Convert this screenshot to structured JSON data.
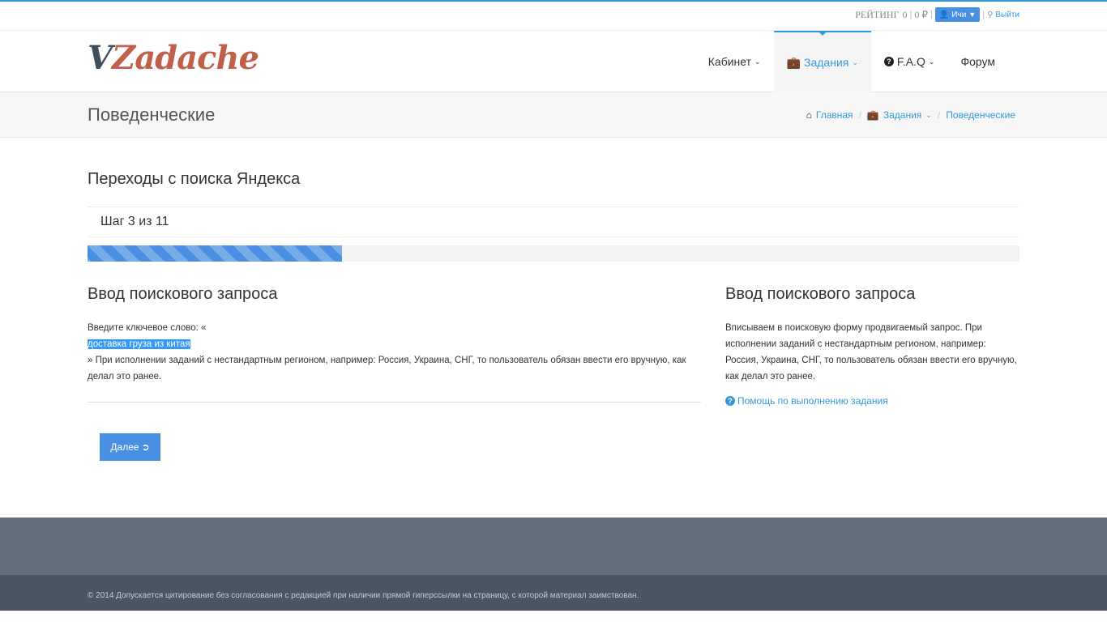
{
  "topbar": {
    "rating_label": "РЕЙТИНГ",
    "rating_value": "0",
    "balance": "0 ₽",
    "user_label": "Ичи",
    "logout_label": "Выйти"
  },
  "header": {
    "logo_v": "V",
    "logo_rest": "Zadache",
    "nav": [
      {
        "label": "Кабинет"
      },
      {
        "label": "Задания"
      },
      {
        "label": "F.A.Q"
      },
      {
        "label": "Форум"
      }
    ]
  },
  "breadcrumb": {
    "page_title": "Поведенческие",
    "items": [
      "Главная",
      "Задания",
      "Поведенческие"
    ]
  },
  "task": {
    "title": "Переходы с поиска Яндекса",
    "step_text": "Шаг 3 из 11",
    "progress_fraction": 0.273
  },
  "left": {
    "section_title": "Ввод поискового запроса",
    "intro": "Введите ключевое слово: «",
    "keyword": "доставка груза из китая",
    "rest": "» При исполнении заданий с нестандартным регионом, например: Россия, Украина, СНГ, то пользователь обязан ввести его вручную, как делал это ранее."
  },
  "right": {
    "section_title": "Ввод поискового запроса",
    "text": "Вписываем в поисковую форму продвигаемый запрос. При исполнении заданий с нестандартным регионом, например: Россия, Украина, СНГ, то пользователь обязан ввести его вручную, как делал это ранее.",
    "help_link": "Помощь по выполнению задания"
  },
  "next_button": "Далее",
  "copyright": "© 2014 Допускается цитирование без согласования с редакцией при наличии прямой гиперссылки на страницу, с которой материал заимствован.",
  "colors": {
    "accent": "#3498db",
    "button": "#4a90e2",
    "footer": "#636f7e",
    "copyright_bg": "#4b5563"
  }
}
